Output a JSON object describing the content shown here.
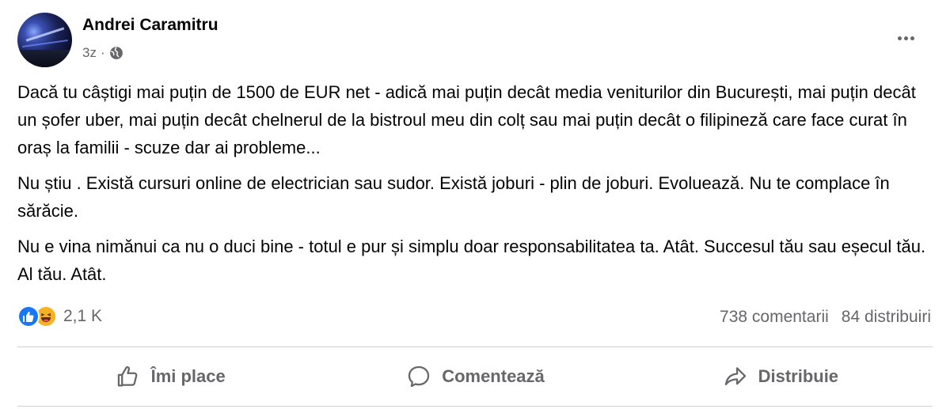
{
  "post": {
    "author": "Andrei Caramitru",
    "time": "3z",
    "separator": "·",
    "privacy_icon": "globe-icon",
    "more_icon": "more-options-icon",
    "paragraphs": [
      "Dacă tu câștigi mai puțin de 1500 de EUR net - adică mai puțin decât media veniturilor din București, mai puțin decât un șofer uber, mai puțin decât chelnerul de la bistroul meu din colț sau mai puțin decât o filipineză care face curat în oraș la familii - scuze dar ai probleme...",
      "Nu știu . Există cursuri online de electrician sau sudor. Există joburi - plin de joburi. Evoluează. Nu te complace în sărăcie.",
      "Nu e vina nimănui ca nu o duci bine - totul e pur și simplu doar responsabilitatea ta. Atât. Succesul tău sau eșecul tău. Al tău. Atât."
    ]
  },
  "stats": {
    "reaction_icons": [
      "like-icon",
      "haha-icon"
    ],
    "reaction_count": "2,1 K",
    "comments": "738 comentarii",
    "shares": "84 distribuiri"
  },
  "actions": {
    "like": "Îmi place",
    "comment": "Comentează",
    "share": "Distribuie"
  },
  "colors": {
    "like_blue": "#1877f2",
    "haha_yellow": "#f7b125",
    "secondary_text": "#65676b"
  }
}
